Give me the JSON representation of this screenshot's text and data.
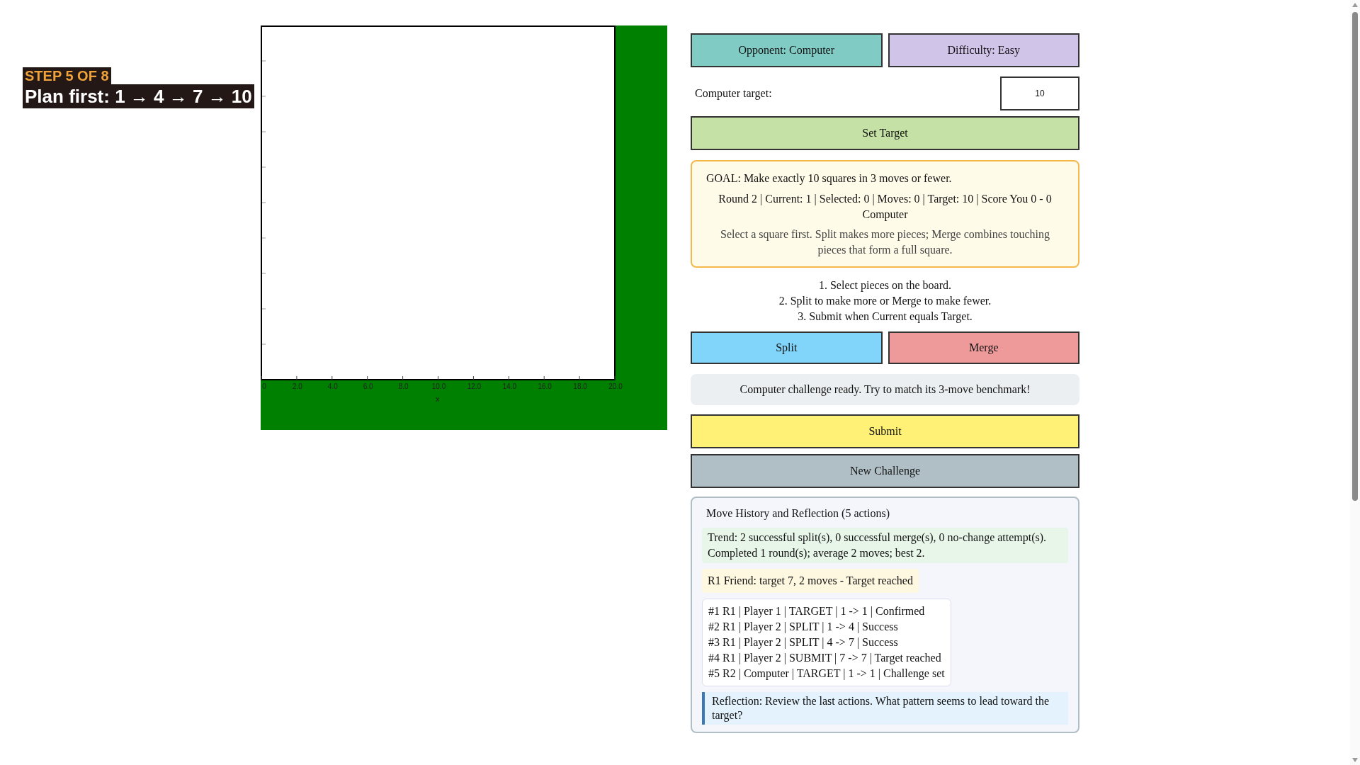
{
  "step_banner": {
    "step": "STEP 5 OF 8",
    "plan": "Plan first: 1 → 4 → 7 → 10"
  },
  "board": {
    "x_ticks": [
      "0",
      "2.0",
      "4.0",
      "6.0",
      "8.0",
      "10.0",
      "12.0",
      "14.0",
      "16.0",
      "18.0",
      "20.0"
    ],
    "x_axis_label": "x"
  },
  "mode_buttons": [
    {
      "label": "Opponent: Computer",
      "kind": "opponent"
    },
    {
      "label": "Difficulty: Easy",
      "kind": "difficulty"
    }
  ],
  "target_field": {
    "label": "Computer target:",
    "value": "10"
  },
  "set_target_button": "Set Target",
  "goal_card": {
    "goal": "GOAL: Make exactly 10 squares in 3 moves or fewer.",
    "status": "Round 2 | Current: 1 | Selected: 0 | Moves: 0 | Target: 10 | Score You 0 - 0 Computer",
    "hint": "Select a square first. Split makes more pieces; Merge combines touching pieces that form a full square."
  },
  "instructions": [
    "1. Select pieces on the board.",
    "2. Split to make more or Merge to make fewer.",
    "3. Submit when Current equals Target."
  ],
  "action_buttons": [
    {
      "label": "Split",
      "kind": "split"
    },
    {
      "label": "Merge",
      "kind": "merge"
    }
  ],
  "message": "Computer challenge ready. Try to match its 3-move benchmark!",
  "submit_button": "Submit",
  "new_challenge_button": "New Challenge",
  "history": {
    "title": "Move History and Reflection (5 actions)",
    "trend": "Trend: 2 successful split(s), 0 successful merge(s), 0 no-change attempt(s). Completed 1 round(s); average 2 moves; best 2.",
    "round_summary": "R1 Friend: target 7, 2 moves - Target reached",
    "log": [
      "#1 R1 | Player 1 | TARGET | 1 -> 1 | Confirmed",
      "#2 R1 | Player 2 | SPLIT | 1 -> 4 | Success",
      "#3 R1 | Player 2 | SPLIT | 4 -> 7 | Success",
      "#4 R1 | Player 2 | SUBMIT | 7 -> 7 | Target reached",
      "#5 R2 | Computer | TARGET | 1 -> 1 | Challenge set"
    ],
    "reflection": "Reflection: Review the last actions. What pattern seems to lead toward the target?"
  }
}
